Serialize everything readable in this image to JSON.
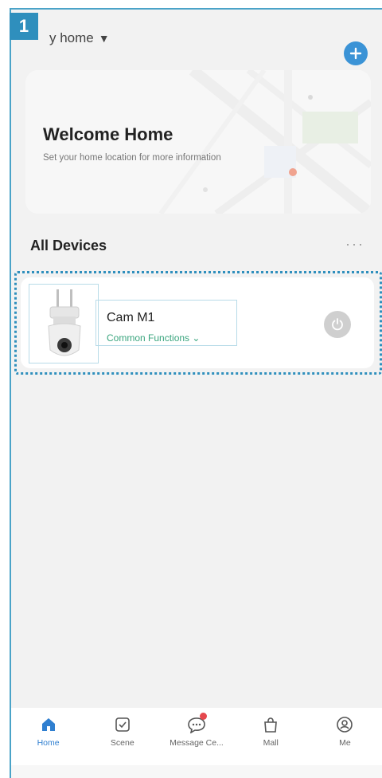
{
  "step_number": "1",
  "header": {
    "home_selector_label": "y home",
    "caret": "▼",
    "add_icon": "plus-circle-icon"
  },
  "welcome": {
    "title": "Welcome Home",
    "subtitle": "Set your home location for more information"
  },
  "devices": {
    "section_title": "All Devices",
    "more_label": "···",
    "items": [
      {
        "name": "Cam M1",
        "functions_label": "Common Functions ⌄",
        "power_icon": "power-icon"
      }
    ]
  },
  "tabbar": {
    "tabs": [
      {
        "label": "Home",
        "icon": "home-icon",
        "active": true
      },
      {
        "label": "Scene",
        "icon": "checkbox-icon",
        "active": false
      },
      {
        "label": "Message Ce...",
        "icon": "chat-bubble-icon",
        "active": false,
        "badge": true
      },
      {
        "label": "Mall",
        "icon": "shopping-bag-icon",
        "active": false
      },
      {
        "label": "Me",
        "icon": "user-icon",
        "active": false
      }
    ]
  },
  "colors": {
    "accent": "#2f7fd0",
    "highlight_border": "#2f8fbd",
    "functions_text": "#3aa57e",
    "badge": "#e5484d"
  }
}
